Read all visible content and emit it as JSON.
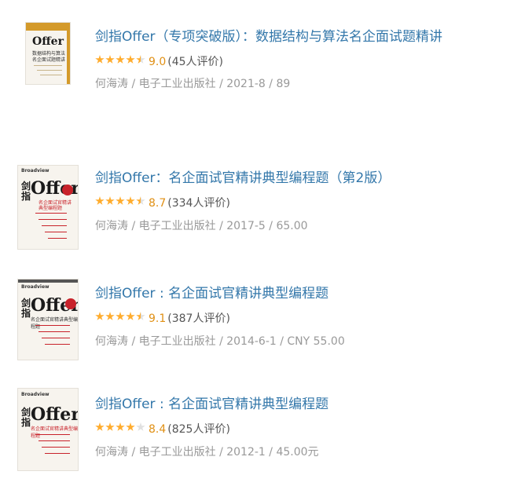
{
  "books": [
    {
      "title": "剑指Offer（专项突破版）：数据结构与算法名企面试题精讲",
      "stars": 4.5,
      "score": "9.0",
      "count": "(45人评价)",
      "meta": "何海涛 / 电子工业出版社 / 2021-8 / 89",
      "cover": {
        "brand": "Offer",
        "accent": "#d49a2a"
      }
    },
    {
      "title": "剑指Offer：名企面试官精讲典型编程题（第2版）",
      "stars": 4.5,
      "score": "8.7",
      "count": "(334人评价)",
      "meta": "何海涛 / 电子工业出版社 / 2017-5 / 65.00",
      "cover": {
        "brand": "Offer",
        "accent": "#c8222a"
      }
    },
    {
      "title": "剑指Offer : 名企面试官精讲典型编程题",
      "stars": 4.5,
      "score": "9.1",
      "count": "(387人评价)",
      "meta": "何海涛 / 电子工业出版社 / 2014-6-1 / CNY 55.00",
      "cover": {
        "brand": "Offer",
        "accent": "#c8222a"
      }
    },
    {
      "title": "剑指Offer : 名企面试官精讲典型编程题",
      "stars": 4,
      "score": "8.4",
      "count": "(825人评价)",
      "meta": "何海涛 / 电子工业出版社 / 2012-1 / 45.00元",
      "cover": {
        "brand": "Offer",
        "accent": "#c8222a"
      }
    }
  ],
  "colors": {
    "link": "#3377aa",
    "star_on": "#ffac2d",
    "star_off": "#e0e0e0",
    "score": "#e09015"
  }
}
